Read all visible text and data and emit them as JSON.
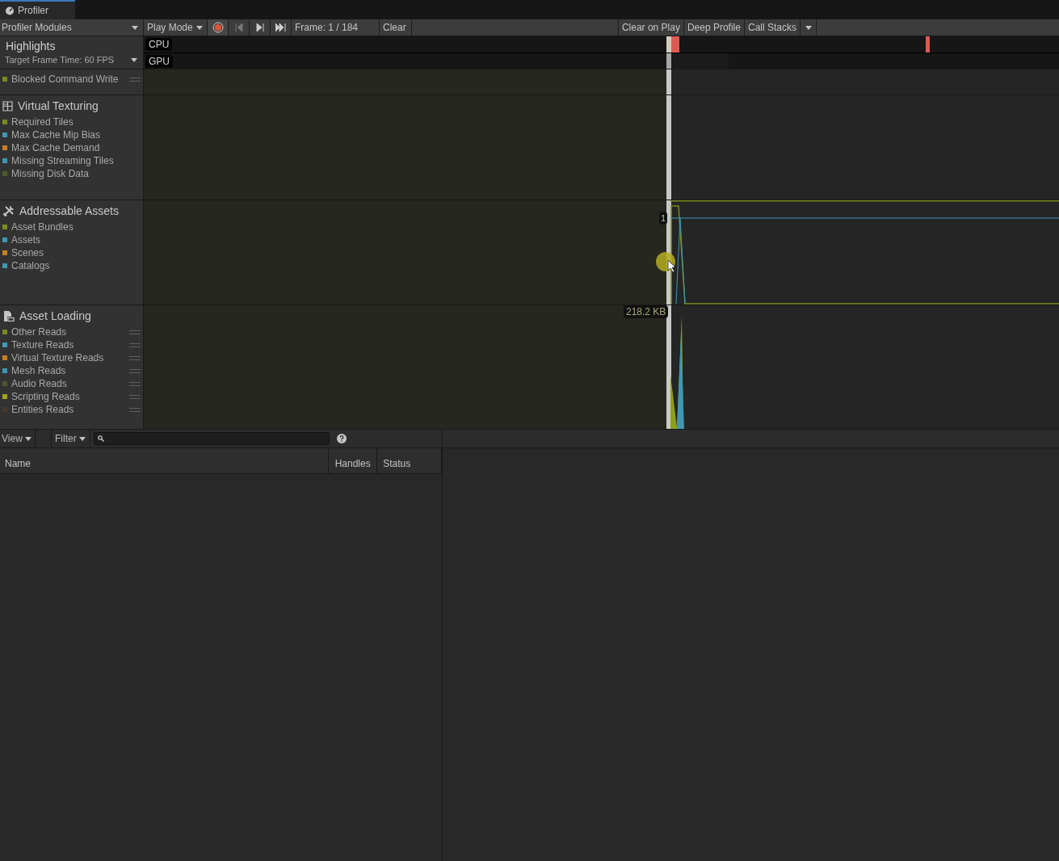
{
  "window": {
    "tab": "Profiler"
  },
  "toolbar": {
    "modules_dropdown": "Profiler Modules",
    "play_mode": "Play Mode",
    "frame": "Frame: 1 / 184",
    "clear": "Clear",
    "clear_on_play": "Clear on Play",
    "deep_profile": "Deep Profile",
    "call_stacks": "Call Stacks"
  },
  "highlights": {
    "title": "Highlights",
    "target": "Target Frame Time: 60 FPS",
    "lanes": [
      "CPU",
      "GPU"
    ]
  },
  "modules": [
    {
      "series": [
        {
          "label": "Blocked Command Write",
          "color": "#7a8a1c",
          "handle": true
        }
      ]
    },
    {
      "title": "Virtual Texturing",
      "kind": "grid",
      "series": [
        {
          "label": "Required Tiles",
          "color": "#7a8a1c",
          "handle": false
        },
        {
          "label": "Max Cache Mip Bias",
          "color": "#3e97b3",
          "handle": false
        },
        {
          "label": "Max Cache Demand",
          "color": "#c47f22",
          "handle": false
        },
        {
          "label": "Missing Streaming Tiles",
          "color": "#3e97b3",
          "handle": false
        },
        {
          "label": "Missing Disk Data",
          "color": "#4c5a2c",
          "handle": false
        }
      ]
    },
    {
      "title": "Addressable Assets",
      "kind": "tools",
      "value_label": "1",
      "series": [
        {
          "label": "Asset Bundles",
          "color": "#7a8a1c",
          "handle": false
        },
        {
          "label": "Assets",
          "color": "#3e97b3",
          "handle": false
        },
        {
          "label": "Scenes",
          "color": "#c47f22",
          "handle": false
        },
        {
          "label": "Catalogs",
          "color": "#3e97b3",
          "handle": false
        }
      ]
    },
    {
      "title": "Asset Loading",
      "kind": "file",
      "value_label": "218.2 KB",
      "series": [
        {
          "label": "Other Reads",
          "color": "#7a8a1c",
          "handle": true
        },
        {
          "label": "Texture Reads",
          "color": "#3e97b3",
          "handle": true
        },
        {
          "label": "Virtual Texture Reads",
          "color": "#c47f22",
          "handle": true
        },
        {
          "label": "Mesh Reads",
          "color": "#3e97b3",
          "handle": true
        },
        {
          "label": "Audio Reads",
          "color": "#4c5a2c",
          "handle": true
        },
        {
          "label": "Scripting Reads",
          "color": "#a5a31c",
          "handle": true
        },
        {
          "label": "Entities Reads",
          "color": "#4a392b",
          "handle": true
        }
      ]
    }
  ],
  "details": {
    "view": "View",
    "filter": "Filter",
    "columns": [
      "Name",
      "Handles",
      "Status"
    ]
  }
}
